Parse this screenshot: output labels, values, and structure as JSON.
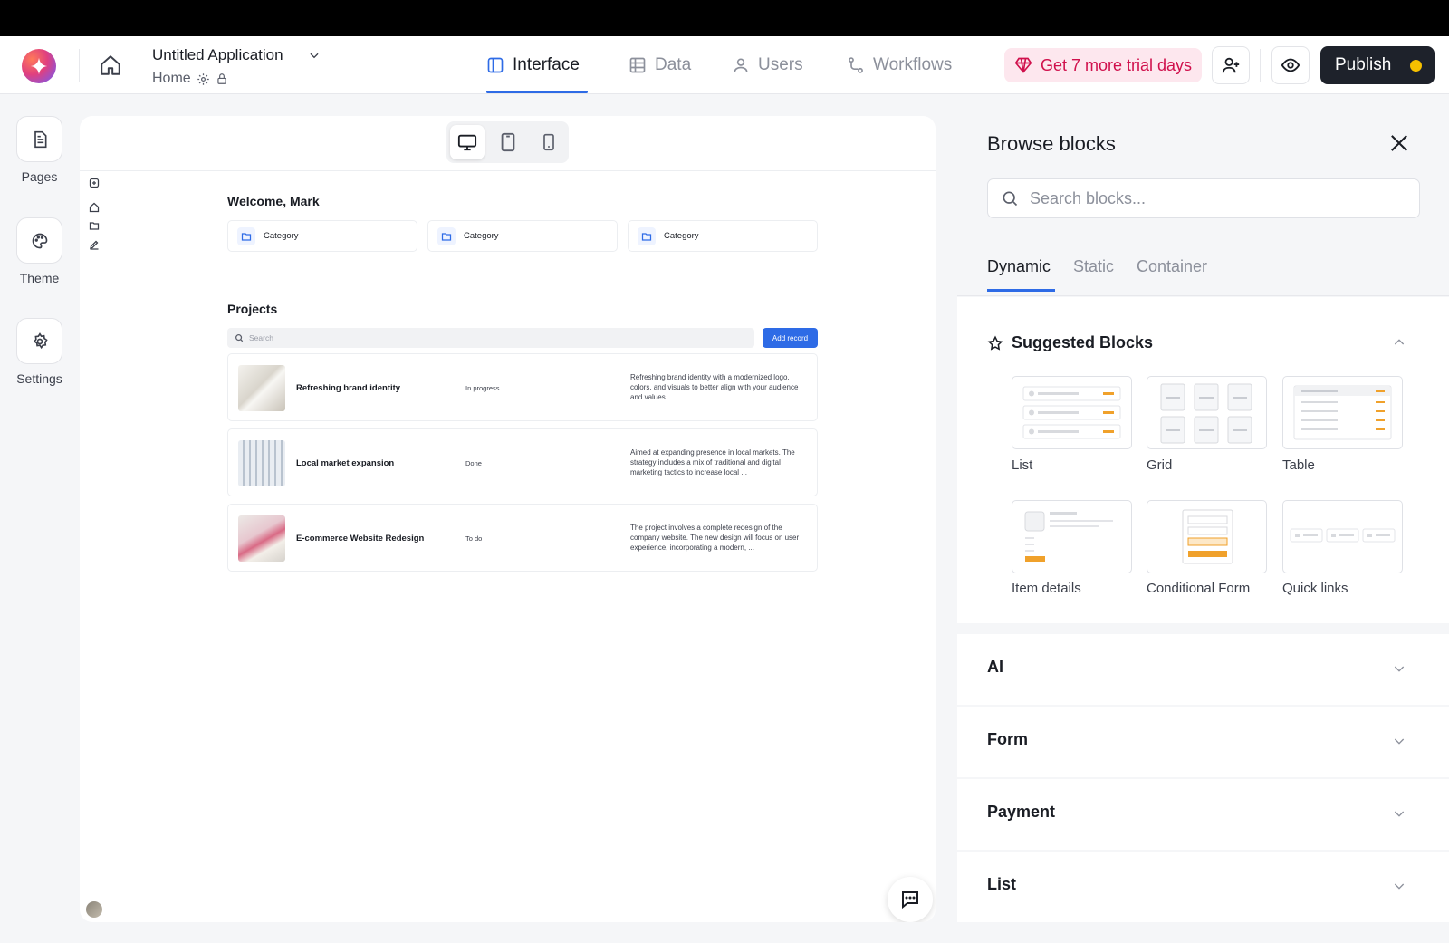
{
  "header": {
    "app_title": "Untitled Application",
    "page_name": "Home",
    "nav": [
      {
        "label": "Interface",
        "icon": "layout-icon"
      },
      {
        "label": "Data",
        "icon": "table-icon"
      },
      {
        "label": "Users",
        "icon": "user-icon"
      },
      {
        "label": "Workflows",
        "icon": "workflow-icon"
      }
    ],
    "trial_label": "Get 7 more trial days",
    "publish_label": "Publish",
    "colors": {
      "accent": "#2e6be6",
      "trial_text": "#d0104c",
      "trial_bg": "#fde7ee",
      "publish_bg": "#1e222b",
      "publish_dot": "#f6c000"
    }
  },
  "sidebar": {
    "items": [
      {
        "label": "Pages",
        "icon": "page-icon"
      },
      {
        "label": "Theme",
        "icon": "palette-icon"
      },
      {
        "label": "Settings",
        "icon": "gear-icon"
      }
    ]
  },
  "canvas": {
    "welcome": "Welcome, Mark",
    "categories": [
      "Category",
      "Category",
      "Category"
    ],
    "projects_title": "Projects",
    "search_placeholder": "Search",
    "add_record_label": "Add record",
    "rows": [
      {
        "name": "Refreshing brand identity",
        "status": "In progress",
        "desc": "Refreshing brand identity with a modernized logo, colors, and visuals to better align with your audience and values."
      },
      {
        "name": "Local market expansion",
        "status": "Done",
        "desc": "Aimed at expanding presence in local markets. The strategy includes a mix of traditional and digital marketing tactics to increase local ..."
      },
      {
        "name": "E-commerce Website Redesign",
        "status": "To do",
        "desc": "The project involves a complete redesign of the company website. The new design will focus on user experience, incorporating a modern, ..."
      }
    ]
  },
  "panel": {
    "title": "Browse blocks",
    "search_placeholder": "Search blocks...",
    "tabs": [
      "Dynamic",
      "Static",
      "Container"
    ],
    "suggested_title": "Suggested Blocks",
    "blocks": [
      "List",
      "Grid",
      "Table",
      "Item details",
      "Conditional Form",
      "Quick links"
    ],
    "sections": [
      "AI",
      "Form",
      "Payment",
      "List"
    ]
  }
}
